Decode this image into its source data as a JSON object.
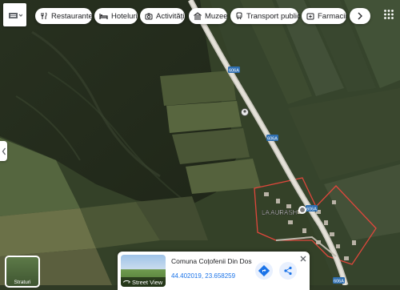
{
  "map": {
    "road_label": "606A",
    "place_label": "LA AURASH",
    "colors": {
      "forest": "#2d3722",
      "field_dark": "#3e4a2c",
      "field_light": "#5e6b45",
      "road": "#c9c6bd",
      "route_shield": "#2f6fb1",
      "boundary": "#e0473c"
    }
  },
  "layers_button": {
    "icon": "layers-icon"
  },
  "chips": [
    {
      "label": "Restaurante",
      "icon": "restaurant-icon"
    },
    {
      "label": "Hoteluri",
      "icon": "hotel-icon"
    },
    {
      "label": "Activități",
      "icon": "camera-icon"
    },
    {
      "label": "Muzee",
      "icon": "museum-icon"
    },
    {
      "label": "Transport public",
      "icon": "train-icon"
    },
    {
      "label": "Farmacii",
      "icon": "pharmacy-icon"
    }
  ],
  "layer_thumb": {
    "label": "Straturi"
  },
  "info_card": {
    "title": "Comuna Coțofenii Din Dos",
    "coordinates": "44.402019, 23.658259",
    "street_view_label": "Street View"
  }
}
